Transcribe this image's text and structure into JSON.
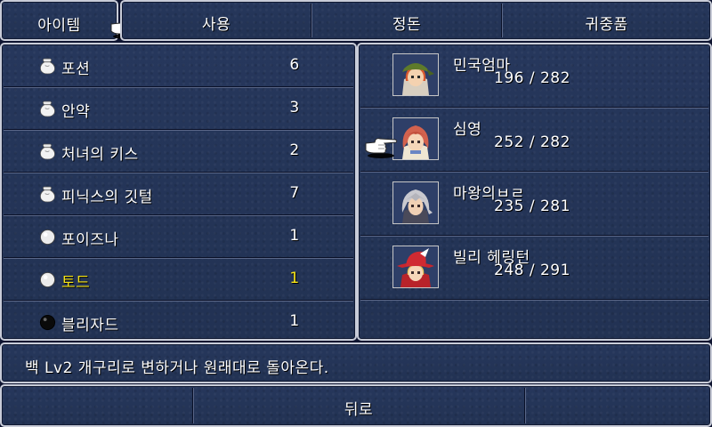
{
  "header": {
    "title": "아이템",
    "tabs": [
      {
        "label": "사용"
      },
      {
        "label": "정돈"
      },
      {
        "label": "귀중품"
      }
    ]
  },
  "items": [
    {
      "name": "포션",
      "qty": "6",
      "icon": "pouch-icon",
      "selected": false
    },
    {
      "name": "안약",
      "qty": "3",
      "icon": "pouch-icon",
      "selected": false
    },
    {
      "name": "처녀의 키스",
      "qty": "2",
      "icon": "pouch-icon",
      "selected": false
    },
    {
      "name": "피닉스의 깃털",
      "qty": "7",
      "icon": "pouch-icon",
      "selected": false
    },
    {
      "name": "포이즈나",
      "qty": "1",
      "icon": "white-orb-icon",
      "selected": false
    },
    {
      "name": "토드",
      "qty": "1",
      "icon": "white-orb-icon",
      "selected": true
    },
    {
      "name": "블리자드",
      "qty": "1",
      "icon": "black-orb-icon",
      "selected": false
    }
  ],
  "party": [
    {
      "name": "민국엄마",
      "hp": "196 / 282",
      "portrait": "green-bandana-portrait",
      "cursor": false
    },
    {
      "name": "심영",
      "hp": "252 / 282",
      "portrait": "red-hair-portrait",
      "cursor": true
    },
    {
      "name": "마왕의ㅂㄹ",
      "hp": "235 / 281",
      "portrait": "silver-hair-portrait",
      "cursor": false
    },
    {
      "name": "빌리 헤링턴",
      "hp": "248 / 291",
      "portrait": "red-mage-portrait",
      "cursor": false
    }
  ],
  "description": "백 Lv2 개구리로 변하거나 원래대로 돌아온다.",
  "footer": {
    "back_label": "뒤로"
  },
  "colors": {
    "panel": "#243457",
    "border": "#c8ccd8",
    "highlight": "#f6e418"
  }
}
